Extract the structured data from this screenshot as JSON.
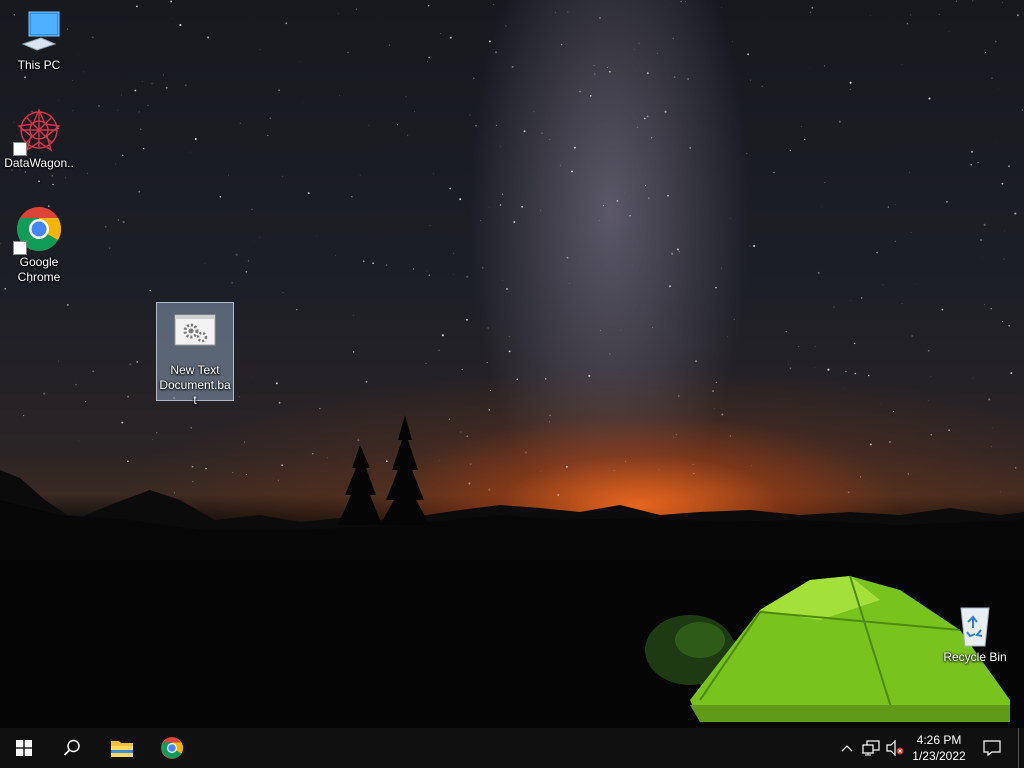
{
  "desktop": {
    "icons": [
      {
        "label": "This PC",
        "icon": "computer-icon"
      },
      {
        "label": "DataWagon...",
        "icon": "datawagon-icon"
      },
      {
        "label": "Google Chrome",
        "icon": "chrome-icon"
      },
      {
        "label": "New Text Document.bat",
        "icon": "batch-file-icon",
        "selected": true
      },
      {
        "label": "Recycle Bin",
        "icon": "recycle-bin-icon"
      }
    ]
  },
  "taskbar": {
    "start": {
      "icon": "windows-logo-icon"
    },
    "search": {
      "icon": "search-icon"
    },
    "pinned": [
      {
        "name": "File Explorer",
        "icon": "folder-icon"
      },
      {
        "name": "Google Chrome",
        "icon": "chrome-icon"
      }
    ],
    "tray": {
      "chevron": "chevron-up-icon",
      "network": "network-icon",
      "volume": "volume-muted-icon",
      "notifications": "notification-icon"
    },
    "clock": {
      "time": "4:26 PM",
      "date": "1/23/2022"
    }
  }
}
